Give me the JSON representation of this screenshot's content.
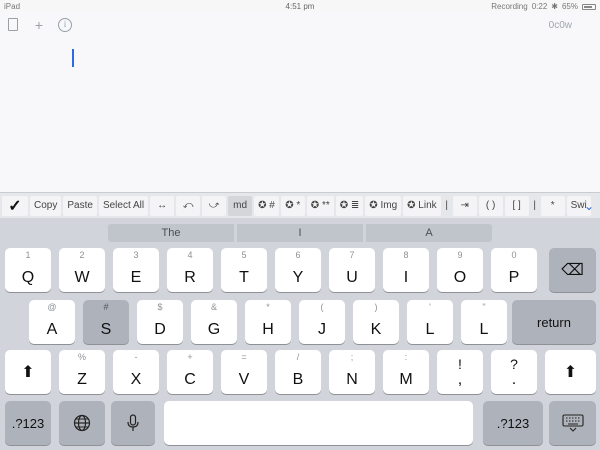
{
  "status_bar": {
    "device": "iPad",
    "time": "4:51 pm",
    "recording": "Recording",
    "recording_time": "0:22",
    "battery": "65%"
  },
  "editor": {
    "icons": [
      "document-icon",
      "plus-icon",
      "info-icon"
    ],
    "word_count": "0c0w",
    "text": ""
  },
  "toolbar": {
    "done_symbol": "✓",
    "buttons": [
      {
        "label": "Copy"
      },
      {
        "label": "Paste"
      },
      {
        "label": "Select All"
      },
      {
        "label": "↔"
      },
      {
        "label": "⤺"
      },
      {
        "label": "⤻"
      },
      {
        "label": "md"
      },
      {
        "label": "✪ #"
      },
      {
        "label": "✪ *"
      },
      {
        "label": "✪ **"
      },
      {
        "label": "✪ ≣"
      },
      {
        "label": "✪ Img"
      },
      {
        "label": "✪ Link"
      },
      {
        "label": "|"
      },
      {
        "label": "⇥"
      },
      {
        "label": "( )"
      },
      {
        "label": "[ ]"
      },
      {
        "label": "|"
      },
      {
        "label": "*"
      },
      {
        "label": "Swi"
      }
    ],
    "chevron": "⌄"
  },
  "predictive": [
    "The",
    "I",
    "A"
  ],
  "keyboard": {
    "row1": [
      {
        "hint": "1",
        "key": "Q"
      },
      {
        "hint": "2",
        "key": "W"
      },
      {
        "hint": "3",
        "key": "E"
      },
      {
        "hint": "4",
        "key": "R"
      },
      {
        "hint": "5",
        "key": "T"
      },
      {
        "hint": "6",
        "key": "Y"
      },
      {
        "hint": "7",
        "key": "U"
      },
      {
        "hint": "8",
        "key": "I"
      },
      {
        "hint": "9",
        "key": "O"
      },
      {
        "hint": "0",
        "key": "P"
      }
    ],
    "row2": [
      {
        "hint": "@",
        "key": "A"
      },
      {
        "hint": "#",
        "key": "S"
      },
      {
        "hint": "$",
        "key": "D"
      },
      {
        "hint": "&",
        "key": "G"
      },
      {
        "hint": "*",
        "key": "H"
      },
      {
        "hint": "(",
        "key": "J"
      },
      {
        "hint": ")",
        "key": "K"
      },
      {
        "hint": "'",
        "key": "L"
      },
      {
        "hint": "\"",
        "key": "L"
      }
    ],
    "row3": [
      {
        "hint": "%",
        "key": "Z"
      },
      {
        "hint": "-",
        "key": "X"
      },
      {
        "hint": "+",
        "key": "C"
      },
      {
        "hint": "=",
        "key": "V"
      },
      {
        "hint": "/",
        "key": "B"
      },
      {
        "hint": ";",
        "key": "N"
      },
      {
        "hint": ":",
        "key": "M"
      },
      {
        "hint": "!",
        "key": ","
      },
      {
        "hint": "?",
        "key": "."
      }
    ],
    "return_label": "return",
    "numbers_label": ".?123",
    "backspace_icon": "⌫",
    "shift_icon": "⬆",
    "globe_icon": "🌐",
    "mic_icon": "🎤",
    "hide_keyboard_icon": "⌨"
  }
}
